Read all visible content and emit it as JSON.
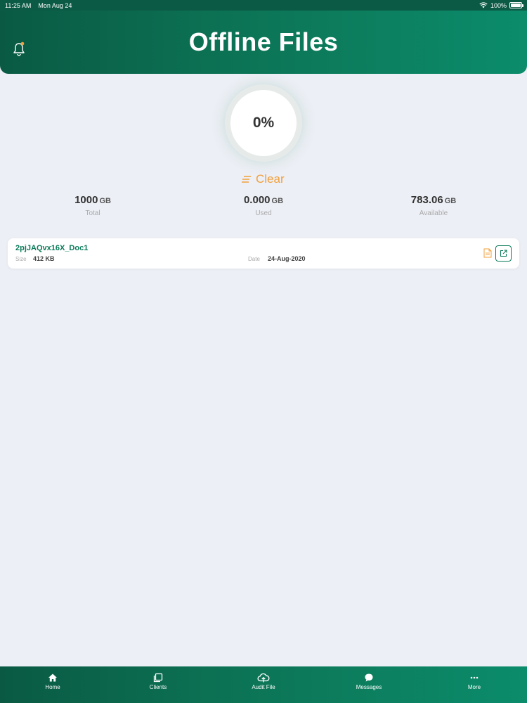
{
  "status_bar": {
    "time": "11:25 AM",
    "date": "Mon Aug 24",
    "battery": "100%",
    "icons": [
      "wifi-icon",
      "battery-icon"
    ]
  },
  "header": {
    "title": "Offline Files",
    "bell_icon": "bell-icon"
  },
  "storage": {
    "progress_label": "0%",
    "progress_value": 0,
    "clear_label": "Clear",
    "total": {
      "value": "1000",
      "unit": "GB",
      "label": "Total"
    },
    "used": {
      "value": "0.000",
      "unit": "GB",
      "label": "Used"
    },
    "available": {
      "value": "783.06",
      "unit": "GB",
      "label": "Available"
    }
  },
  "files": [
    {
      "name": "2pjJAQvx16X_Doc1",
      "size_label": "Size",
      "size": "412 KB",
      "date_label": "Date",
      "date": "24-Aug-2020"
    }
  ],
  "tabbar": {
    "items": [
      {
        "label": "Home",
        "icon": "home-icon"
      },
      {
        "label": "Clients",
        "icon": "clients-icon"
      },
      {
        "label": "Audit File",
        "icon": "cloud-upload-icon"
      },
      {
        "label": "Messages",
        "icon": "chat-icon"
      },
      {
        "label": "More",
        "icon": "more-icon"
      }
    ]
  },
  "colors": {
    "header": "#0b7657",
    "accent": "#f2a03d",
    "file_name": "#0b7b5a",
    "background": "#eceff5"
  }
}
